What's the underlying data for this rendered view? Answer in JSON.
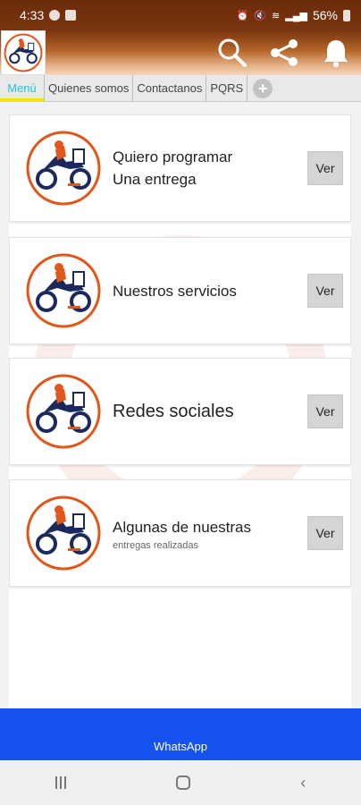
{
  "status_bar": {
    "time": "4:33",
    "battery": "56%"
  },
  "tabs": [
    {
      "label": "Menú"
    },
    {
      "label": "Quienes somos"
    },
    {
      "label": "Contactanos"
    },
    {
      "label": "PQRS"
    }
  ],
  "cards": [
    {
      "line1": "Quiero programar",
      "line2": "Una entrega",
      "button": "Ver"
    },
    {
      "line1": "Nuestros servicios",
      "button": "Ver"
    },
    {
      "line1": "Redes sociales",
      "button": "Ver"
    },
    {
      "line1": "Algunas de nuestras",
      "sub": "entregas realizadas",
      "button": "Ver"
    }
  ],
  "whatsapp": {
    "label": "WhatsApp"
  },
  "colors": {
    "brand_orange": "#e2571c",
    "brand_navy": "#1b2a5b",
    "whatsapp_blue": "#1552ef",
    "tab_active": "#28c3d6"
  },
  "icons": [
    "search-icon",
    "share-icon",
    "bell-icon",
    "plus-icon",
    "delivery-moto-logo"
  ]
}
